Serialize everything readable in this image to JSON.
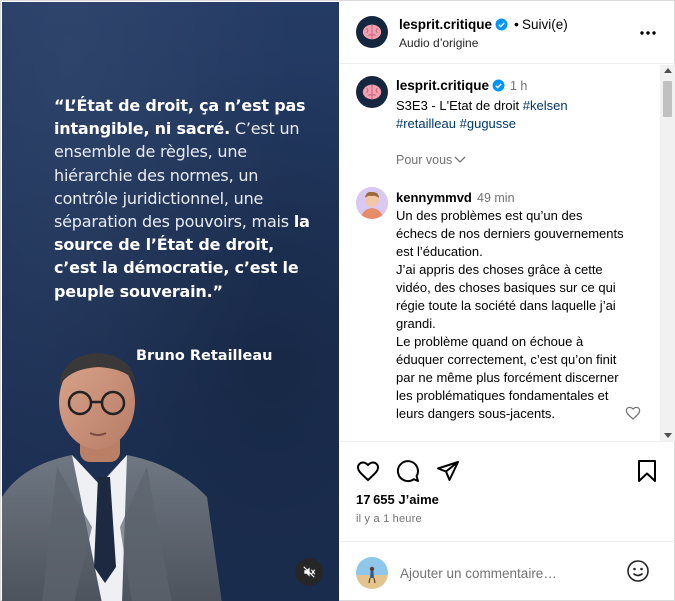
{
  "post": {
    "quote_segments": [
      {
        "text": "“L’État de droit, ça n’est pas intangible,  ni sacré.",
        "bold": true
      },
      {
        "text": " C’est un ensemble de règles, une hiérarchie des normes, un contrôle juridictionnel, une séparation des pouvoirs, mais ",
        "bold": false
      },
      {
        "text": "la source de l’État de droit, c’est la démocratie, c’est le peuple souverain.”",
        "bold": true
      }
    ],
    "author": "Bruno Retailleau",
    "mute_icon": "speaker-muted-icon",
    "background_color": "#1f3358"
  },
  "header": {
    "username": "lesprit.critique",
    "separator": "•",
    "follow_label": "Suivi(e)",
    "audio_label": "Audio d’origine",
    "more_icon": "more-horizontal-icon"
  },
  "caption": {
    "username": "lesprit.critique",
    "time": "1 h",
    "text": "S3E3 - L'Etat de droit",
    "tags": [
      "#kelsen",
      "#retailleau",
      "#gugusse"
    ],
    "for_you_label": "Pour vous"
  },
  "comment": {
    "username": "kennymmvd",
    "time": "49 min",
    "text": "Un des problèmes est qu’un des échecs de nos derniers gouvernements est l’éducation.\nJ’ai appris des choses grâce à cette vidéo, des choses basiques sur ce qui régie toute la société dans laquelle j’ai grandi.\nLe problème quand on échoue à éduquer correctement, c’est qu’on finit par ne même plus forcément discerner les problématiques fondamentales et leurs dangers sous-jacents."
  },
  "actions": {
    "likes_count": "17 655",
    "likes_label": "J’aime",
    "posted_time": "il y a 1 heure"
  },
  "add_comment": {
    "placeholder": "Ajouter un commentaire…"
  },
  "colors": {
    "verified": "#0095f6",
    "hashtag": "#00376b",
    "muted_text": "#737373"
  }
}
